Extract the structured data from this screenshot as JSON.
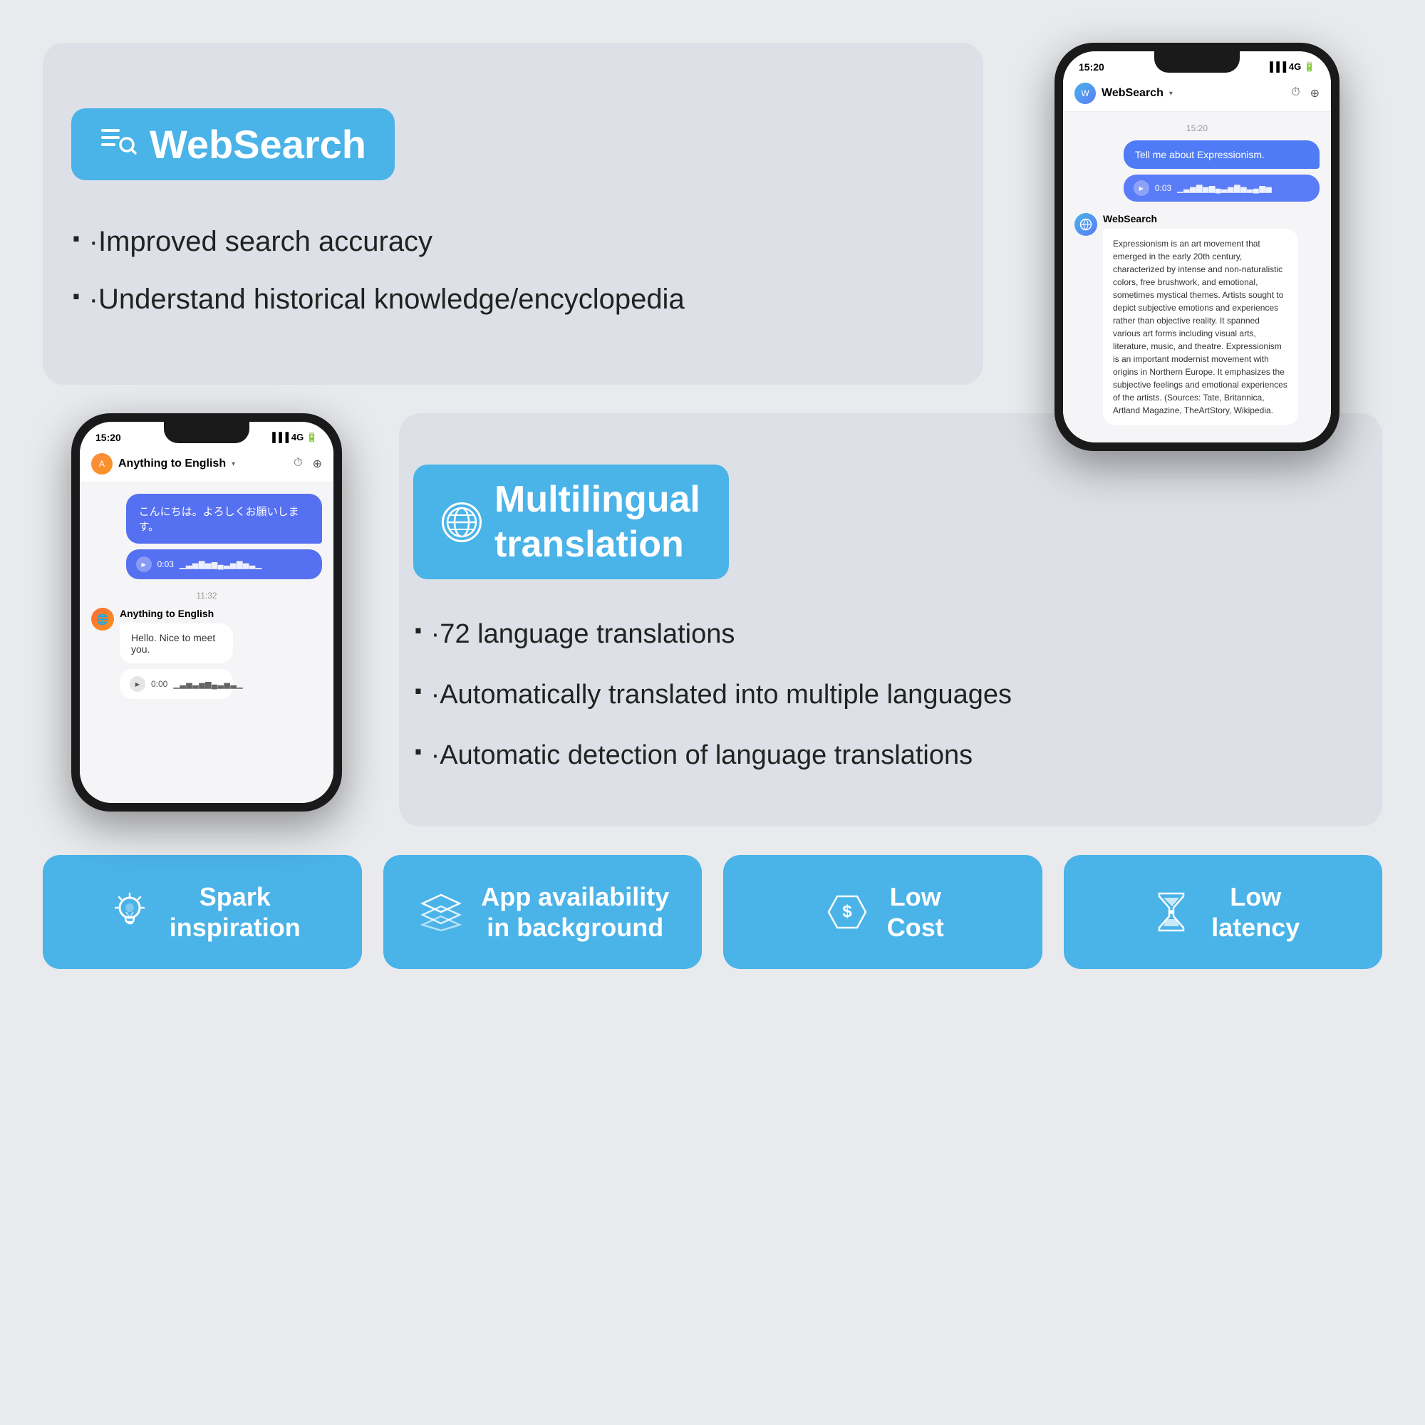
{
  "app": {
    "background": "#e8eaed"
  },
  "websearch": {
    "badge_text": "WebSearch",
    "feature1": "·Improved search accuracy",
    "feature2": "·Understand historical knowledge/encyclopedia"
  },
  "phone1": {
    "time": "15:20",
    "signal": "4G",
    "header_name": "WebSearch",
    "timestamp": "15:20",
    "user_message": "Tell me about Expressionism.",
    "voice_time": "0:03",
    "bot_name": "WebSearch",
    "bot_response": "Expressionism is an art movement that emerged in the early 20th century, characterized by intense and non-naturalistic colors, free brushwork, and emotional, sometimes mystical themes. Artists sought to depict subjective emotions and experiences rather than objective reality. It spanned various art forms including visual arts, literature, music, and theatre. Expressionism is an important modernist movement with origins in Northern Europe. It emphasizes the subjective feelings and emotional experiences of the artists. (Sources: Tate, Britannica, Artland Magazine, TheArtStory, Wikipedia."
  },
  "phone2": {
    "time": "15:20",
    "signal": "4G",
    "header_name": "Anything to English",
    "timestamp": "11:32",
    "jp_message": "こんにちは。よろしくお願いします。",
    "voice_time_jp": "0:03",
    "anything_name": "Anything to English",
    "en_message": "Hello. Nice to meet you.",
    "voice_time_en": "0:00"
  },
  "translation": {
    "badge_text_line1": "Multilingual",
    "badge_text_line2": "translation",
    "feature1": "·72 language translations",
    "feature2": "·Automatically translated into multiple languages",
    "feature3": "·Automatic detection of language translations"
  },
  "footer": {
    "card1_label": "Spark\ninspiration",
    "card2_label": "App availability\nin background",
    "card3_label": "Low\nCost",
    "card4_label": "Low\nlatency"
  }
}
